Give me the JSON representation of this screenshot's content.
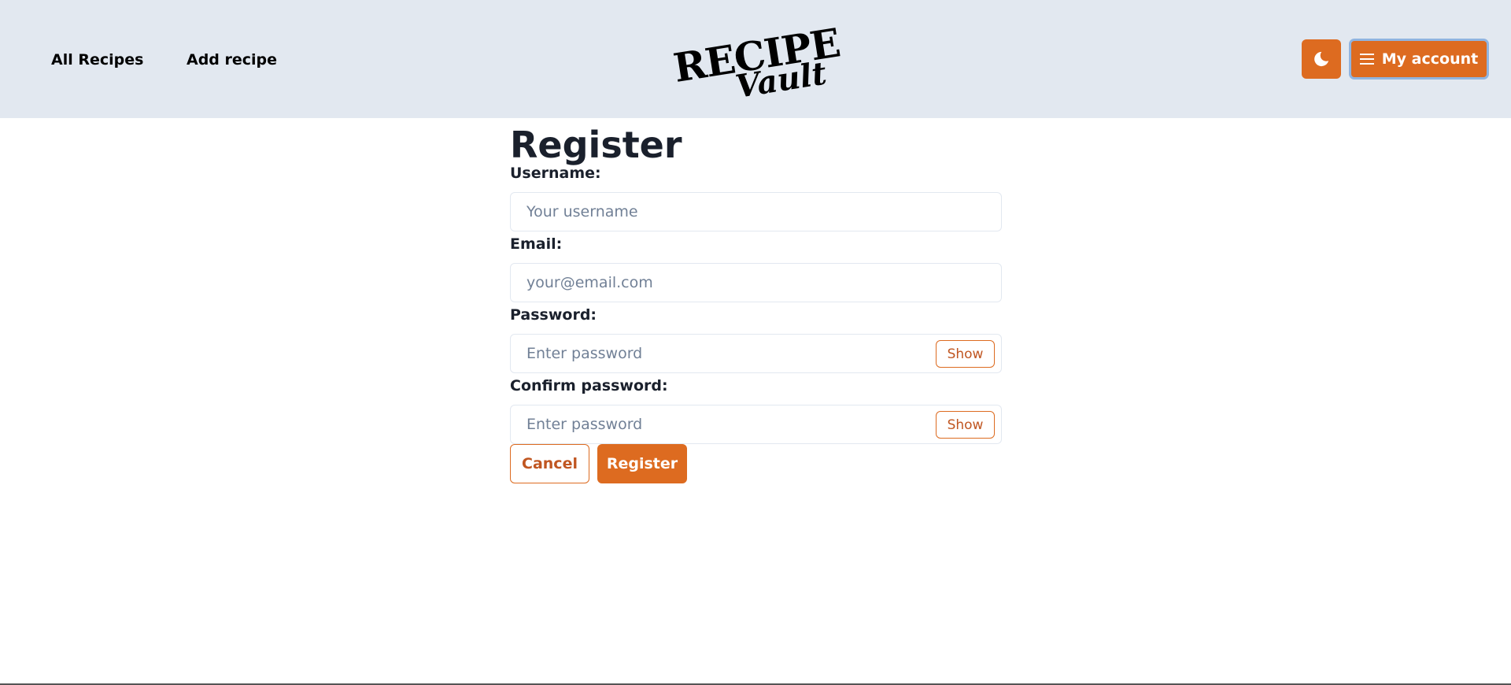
{
  "header": {
    "nav": {
      "all_recipes": "All Recipes",
      "add_recipe": "Add recipe"
    },
    "logo": {
      "line1": "RECIPE",
      "line2": "Vault"
    },
    "theme_toggle_icon": "moon-icon",
    "account_button": {
      "icon": "menu-icon",
      "label": "My account"
    }
  },
  "form": {
    "title": "Register",
    "username": {
      "label": "Username:",
      "placeholder": "Your username",
      "value": ""
    },
    "email": {
      "label": "Email:",
      "placeholder": "your@email.com",
      "value": ""
    },
    "password": {
      "label": "Password:",
      "placeholder": "Enter password",
      "value": "",
      "toggle_label": "Show"
    },
    "confirm_password": {
      "label": "Confirm password:",
      "placeholder": "Enter password",
      "value": "",
      "toggle_label": "Show"
    },
    "cancel_label": "Cancel",
    "submit_label": "Register"
  },
  "colors": {
    "accent": "#dd6b20",
    "header_bg": "#e2e8f0",
    "focus_ring": "#90b4e0"
  }
}
